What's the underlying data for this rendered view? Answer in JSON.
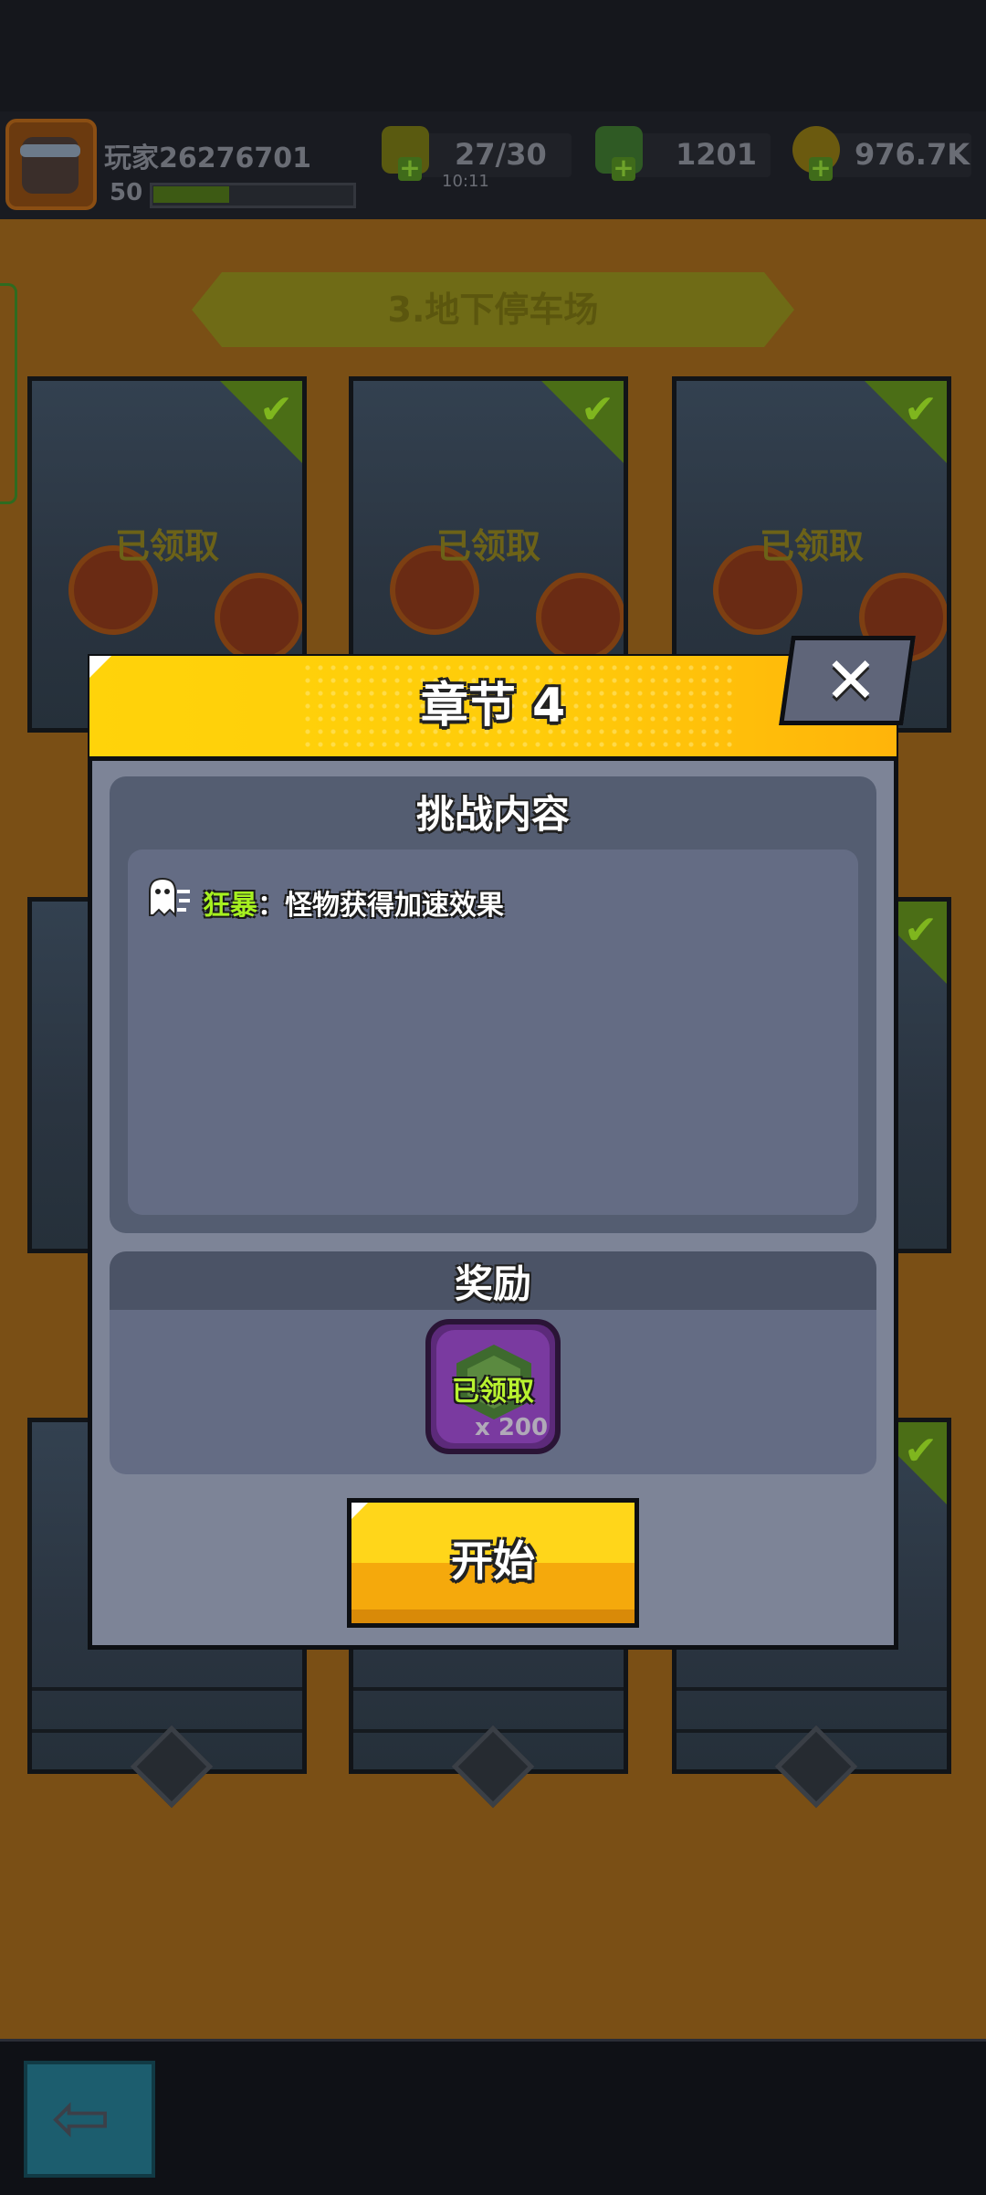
{
  "hud": {
    "player_name": "玩家26276701",
    "level": "50",
    "xp_progress": 0.38,
    "energy": "27/30",
    "energy_timer": "10:11",
    "gems": "1201",
    "gold": "976.7K"
  },
  "stage": {
    "banner": "3.地下停车场",
    "cards": [
      {
        "status": "已领取"
      },
      {
        "status": "已领取"
      },
      {
        "status": "已领取"
      }
    ]
  },
  "modal": {
    "title": "章节 4",
    "challenge_title": "挑战内容",
    "effect_keyword": "狂暴",
    "effect_text": "：怪物获得加速效果",
    "reward_title": "奖励",
    "reward_status": "已领取",
    "reward_quantity": "x 200",
    "start_label": "开始",
    "close_symbol": "✕"
  },
  "nav": {
    "back_symbol": "⇦"
  },
  "colors": {
    "header_yellow": "#ffd30a",
    "button_yellow": "#ffd61a",
    "effect_keyword_green": "#a6f020",
    "panel_gray": "#7d8497"
  },
  "icons": [
    "energy-bolt-icon",
    "gem-icon",
    "gold-coin-icon",
    "plus-icon",
    "ghost-icon",
    "close-icon",
    "back-arrow-icon",
    "check-icon"
  ]
}
